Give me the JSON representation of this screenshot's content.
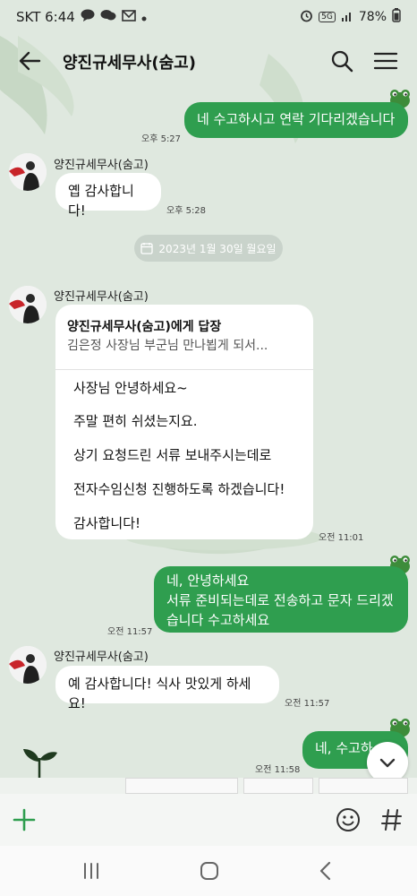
{
  "status_bar": {
    "carrier_time": "SKT 6:44",
    "network": "5G",
    "battery": "78%"
  },
  "header": {
    "title": "양진규세무사(숨고)"
  },
  "messages": {
    "m1_text": "네 수고하시고 연락 기다리겠습니다",
    "m1_time": "오후 5:27",
    "m2_sender": "양진규세무사(숨고)",
    "m2_text": "옙 감사합니다!",
    "m2_time": "오후 5:28",
    "date_separator": "2023년 1월 30일 월요일",
    "m3_sender": "양진규세무사(숨고)",
    "m3_reply_to": "양진규세무사(숨고)에게 답장",
    "m3_reply_quote": "김은정 사장님 부군님  만나뵙게 되서...",
    "m3_lines": [
      "사장님 안녕하세요~",
      "주말 편히 쉬셨는지요.",
      "상기 요청드린 서류 보내주시는데로",
      "전자수임신청 진행하도록 하겠습니다!",
      "감사합니다!"
    ],
    "m3_time": "오전 11:01",
    "m4_lines": [
      "네, 안녕하세요",
      "서류 준비되는데로 전송하고 문자 드리겠",
      "습니다 수고하세요"
    ],
    "m4_time": "오전 11:57",
    "m5_sender": "양진규세무사(숨고)",
    "m5_text": "예 감사합니다! 식사 맛있게 하세요!",
    "m5_time": "오전 11:57",
    "m6_text": "네, 수고하",
    "m6_time": "오전 11:58"
  },
  "icons": {
    "back": "arrow-left-icon",
    "search": "search-icon",
    "menu": "hamburger-menu-icon",
    "add": "plus-icon",
    "emoji": "emoji-icon",
    "hashtag": "hashtag-icon",
    "scroll_down": "chevron-down-icon"
  },
  "colors": {
    "my_bubble": "#2f9e4f",
    "their_bubble": "#ffffff",
    "background": "#dfe8df",
    "accent": "#2f9e4f"
  }
}
